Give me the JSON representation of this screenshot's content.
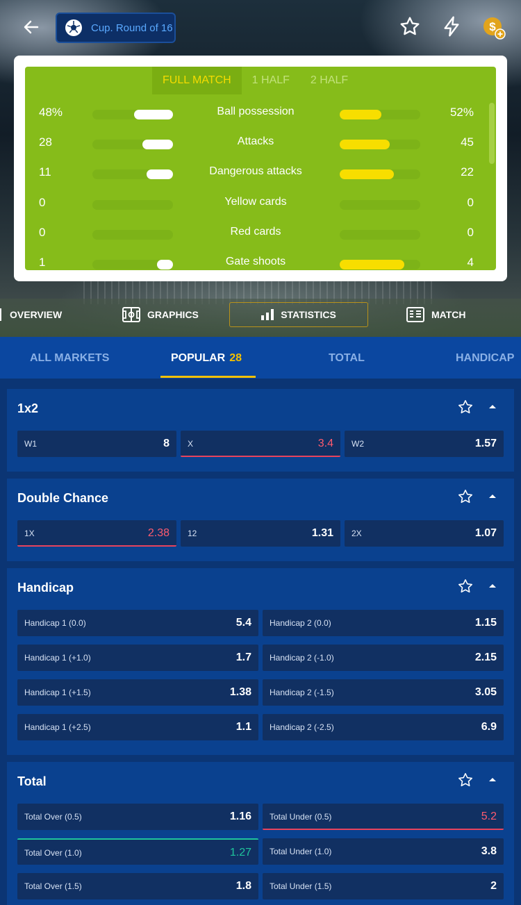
{
  "header": {
    "back_label": "back",
    "competition": "Cup. Round of 16"
  },
  "stats": {
    "periods": [
      "FULL MATCH",
      "1 HALF",
      "2 HALF"
    ],
    "active_period": "FULL MATCH",
    "rows": [
      {
        "name": "Ball possession",
        "home": "48%",
        "away": "52%",
        "home_share": 0.48,
        "away_share": 0.52
      },
      {
        "name": "Attacks",
        "home": "28",
        "away": "45",
        "home_share": 0.38,
        "away_share": 0.62
      },
      {
        "name": "Dangerous attacks",
        "home": "11",
        "away": "22",
        "home_share": 0.33,
        "away_share": 0.67
      },
      {
        "name": "Yellow cards",
        "home": "0",
        "away": "0",
        "home_share": 0,
        "away_share": 0
      },
      {
        "name": "Red cards",
        "home": "0",
        "away": "0",
        "home_share": 0,
        "away_share": 0
      },
      {
        "name": "Gate shoots",
        "home": "1",
        "away": "4",
        "home_share": 0.2,
        "away_share": 0.8
      }
    ]
  },
  "nav": {
    "overview": "OVERVIEW",
    "graphics": "GRAPHICS",
    "statistics": "STATISTICS",
    "match": "MATCH"
  },
  "market_tabs": {
    "all": "ALL MARKETS",
    "popular": "POPULAR",
    "popular_count": "28",
    "total": "TOTAL",
    "handicap": "HANDICAP"
  },
  "markets": {
    "m1x2": {
      "title": "1x2",
      "odds": [
        {
          "label": "W1",
          "value": "8"
        },
        {
          "label": "X",
          "value": "3.4"
        },
        {
          "label": "W2",
          "value": "1.57"
        }
      ]
    },
    "double_chance": {
      "title": "Double Chance",
      "odds": [
        {
          "label": "1X",
          "value": "2.38"
        },
        {
          "label": "12",
          "value": "1.31"
        },
        {
          "label": "2X",
          "value": "1.07"
        }
      ]
    },
    "handicap": {
      "title": "Handicap",
      "odds": [
        {
          "label": "Handicap 1 (0.0)",
          "value": "5.4"
        },
        {
          "label": "Handicap 2 (0.0)",
          "value": "1.15"
        },
        {
          "label": "Handicap 1 (+1.0)",
          "value": "1.7"
        },
        {
          "label": "Handicap 2 (-1.0)",
          "value": "2.15"
        },
        {
          "label": "Handicap 1 (+1.5)",
          "value": "1.38"
        },
        {
          "label": "Handicap 2 (-1.5)",
          "value": "3.05"
        },
        {
          "label": "Handicap 1 (+2.5)",
          "value": "1.1"
        },
        {
          "label": "Handicap 2 (-2.5)",
          "value": "6.9"
        }
      ]
    },
    "total": {
      "title": "Total",
      "odds": [
        {
          "label": "Total Over (0.5)",
          "value": "1.16"
        },
        {
          "label": "Total Under (0.5)",
          "value": "5.2"
        },
        {
          "label": "Total Over (1.0)",
          "value": "1.27"
        },
        {
          "label": "Total Under (1.0)",
          "value": "3.8"
        },
        {
          "label": "Total Over (1.5)",
          "value": "1.8"
        },
        {
          "label": "Total Under (1.5)",
          "value": "2"
        }
      ]
    }
  },
  "colors": {
    "accent_yellow": "#f3c000",
    "pitch_green": "#86bc1a",
    "odds_down_red": "#ff5b6e",
    "odds_up_green": "#1fc49c"
  }
}
